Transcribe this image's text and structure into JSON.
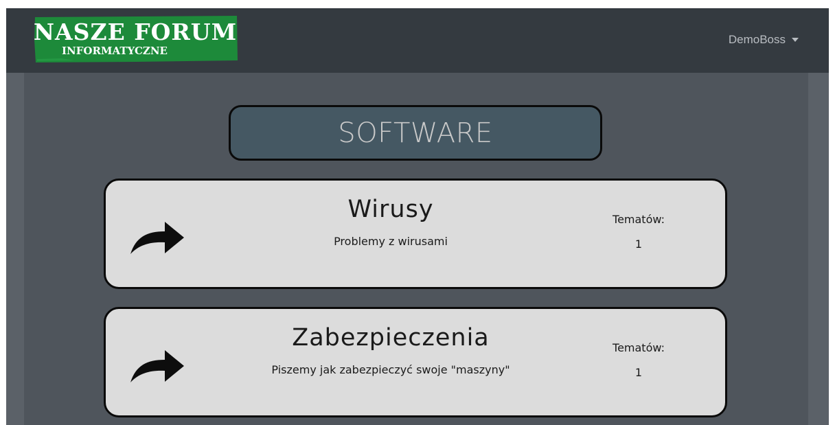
{
  "navbar": {
    "logo": {
      "line1": "NASZE FORUM",
      "line2": "INFORMATYCZNE",
      "color": "#1d8a3a"
    },
    "user": {
      "name": "DemoBoss",
      "icon": "caret-down-icon"
    }
  },
  "category": {
    "title": "SOFTWARE"
  },
  "forums": [
    {
      "title": "Wirusy",
      "description": "Problemy z wirusami",
      "topics_label": "Tematów:",
      "topics_count": "1",
      "icon": "share-arrow-icon"
    },
    {
      "title": "Zabezpieczenia",
      "description": "Piszemy jak zabezpieczyć swoje \"maszyny\"",
      "topics_label": "Tematów:",
      "topics_count": "1",
      "icon": "share-arrow-icon"
    }
  ]
}
